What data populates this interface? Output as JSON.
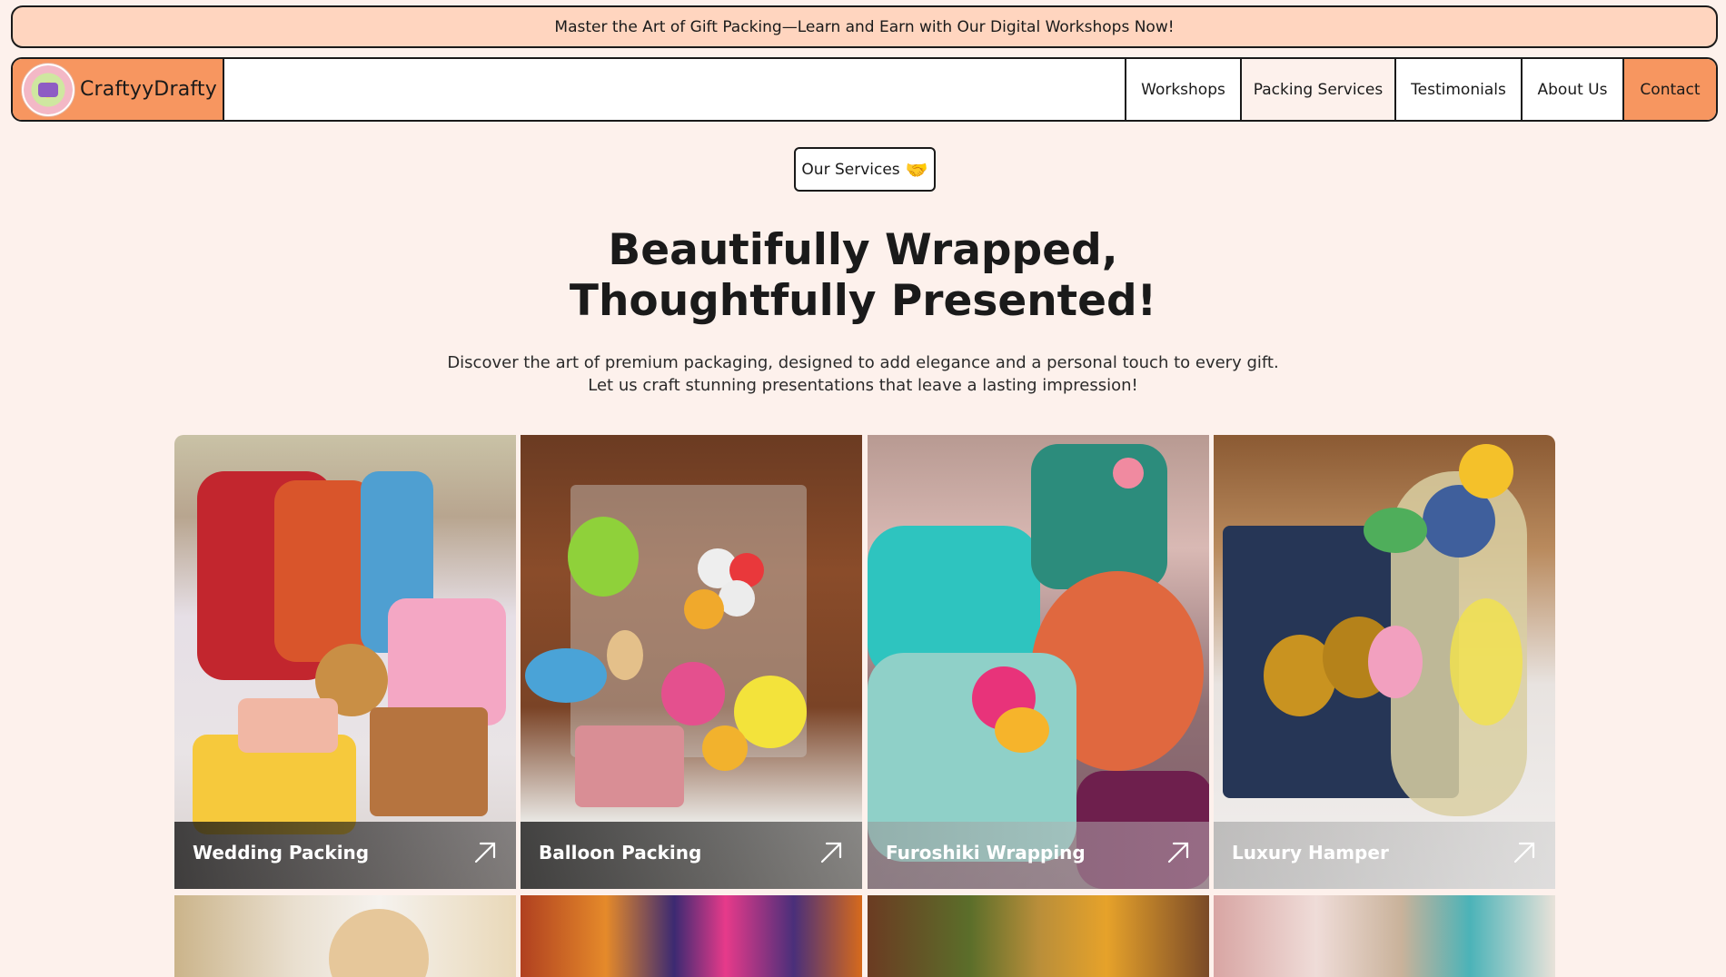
{
  "announcement": "Master the Art of Gift Packing—Learn and Earn with Our Digital Workshops Now!",
  "brand": {
    "name": "CraftyyDrafty"
  },
  "nav": {
    "items": [
      "Workshops",
      "Packing Services",
      "Testimonials",
      "About Us",
      "Contact"
    ]
  },
  "section_tag": {
    "label": "Our Services",
    "icon": "handshake-icon"
  },
  "hero": {
    "title_line1": "Beautifully Wrapped,",
    "title_line2": "Thoughtfully Presented!",
    "subtitle_line1": "Discover the art of premium packaging, designed to add elegance and a personal touch to every gift.",
    "subtitle_line2": "Let us craft stunning presentations that leave a lasting impression!"
  },
  "services": [
    {
      "label": "Wedding Packing",
      "icon": "arrow-up-right-icon"
    },
    {
      "label": "Balloon Packing",
      "icon": "arrow-up-right-icon"
    },
    {
      "label": "Furoshiki Wrapping",
      "icon": "arrow-up-right-icon"
    },
    {
      "label": "Luxury Hamper",
      "icon": "arrow-up-right-icon"
    }
  ],
  "colors": {
    "background": "#fdf1ec",
    "announcement_bg": "#ffd5bf",
    "accent": "#f79660",
    "border": "#1a1a1a"
  }
}
